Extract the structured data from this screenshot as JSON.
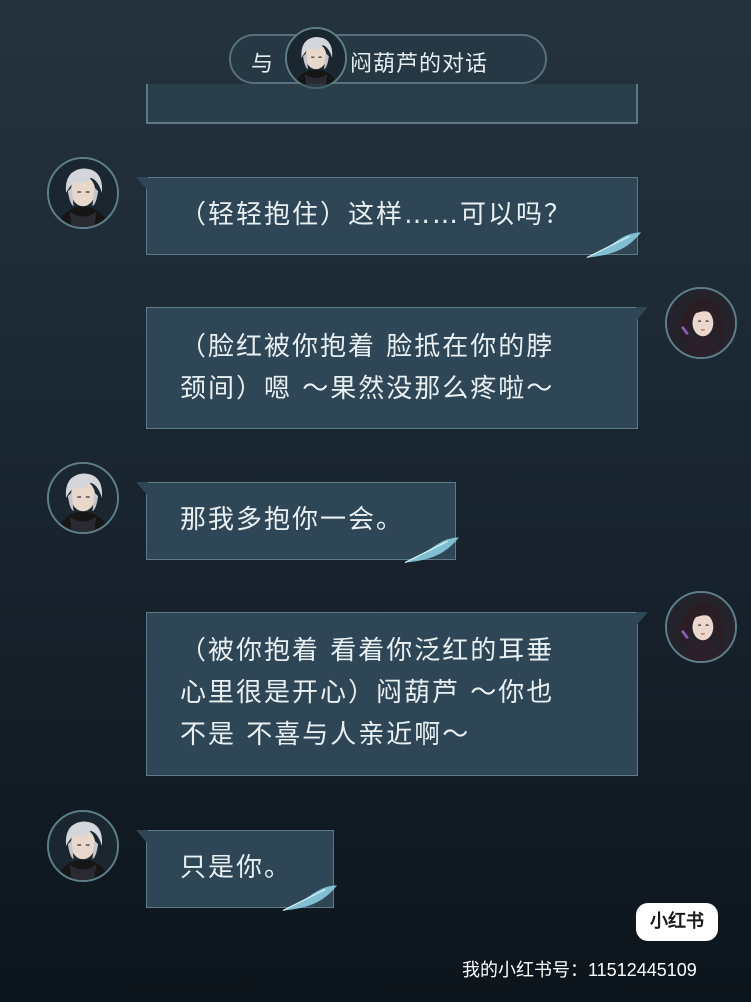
{
  "header": {
    "prefix": "与",
    "suffix": "闷葫芦的对话",
    "avatar_icon": "silver-hair-character-avatar"
  },
  "messages": [
    {
      "sender": "character",
      "avatar_icon": "silver-hair-character-avatar",
      "lines": [
        "（轻轻抱住）这样……可以吗？"
      ]
    },
    {
      "sender": "player",
      "avatar_icon": "dark-hair-player-avatar",
      "lines": [
        "（脸红被你抱着 脸抵在你的脖",
        "颈间）嗯 ～果然没那么疼啦～"
      ]
    },
    {
      "sender": "character",
      "avatar_icon": "silver-hair-character-avatar",
      "lines": [
        "那我多抱你一会。"
      ]
    },
    {
      "sender": "player",
      "avatar_icon": "dark-hair-player-avatar",
      "lines": [
        "（被你抱着 看着你泛红的耳垂",
        "心里很是开心）闷葫芦 ～你也",
        "不是 不喜与人亲近啊～"
      ]
    },
    {
      "sender": "character",
      "avatar_icon": "silver-hair-character-avatar",
      "lines": [
        "只是你。"
      ]
    }
  ],
  "watermark": {
    "logo_text": "小红书",
    "account_text": "我的小红书号：11512445109"
  },
  "colors": {
    "bubble_fill": "#2f4656",
    "bubble_border": "#5e7b88",
    "feather": "#8fd3e6",
    "text": "#e9f0f2"
  }
}
